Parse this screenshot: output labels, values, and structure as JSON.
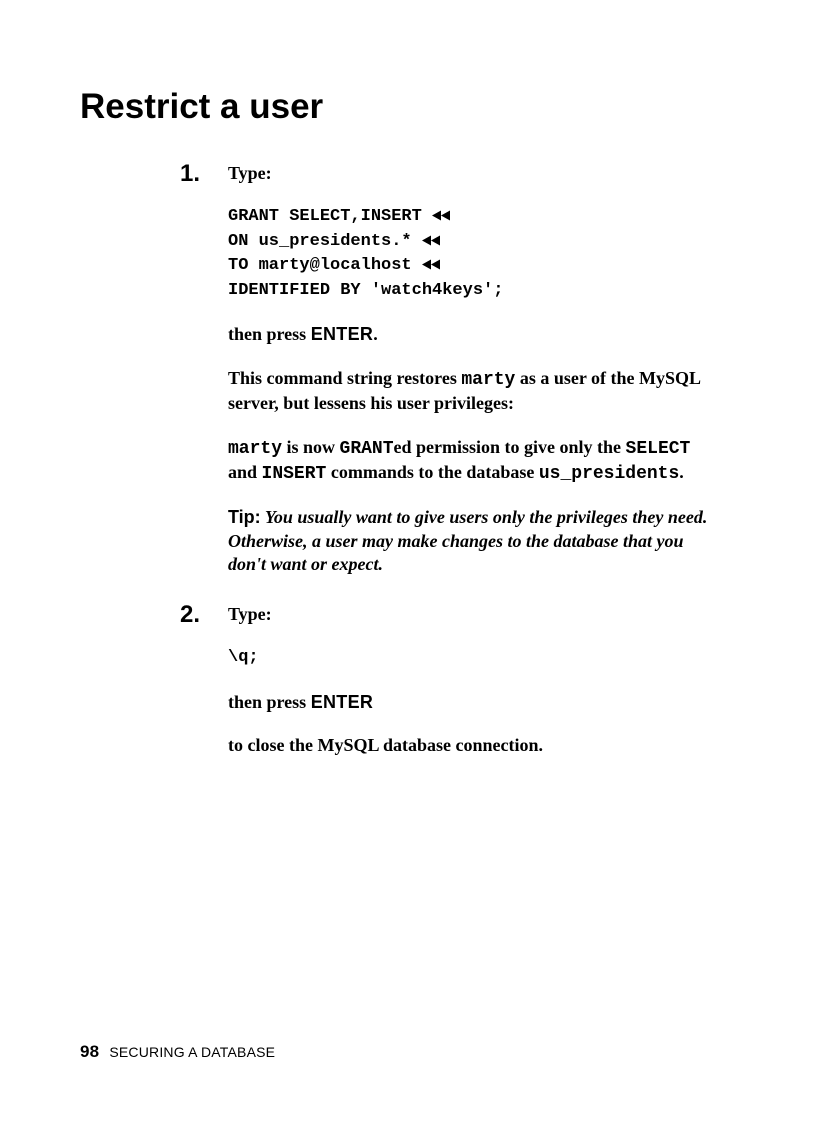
{
  "heading": "Restrict a user",
  "steps": [
    {
      "num": "1.",
      "type_label": "Type:",
      "code_lines": [
        {
          "text": "GRANT SELECT,INSERT ",
          "cont": true
        },
        {
          "text": "ON us_presidents.* ",
          "cont": true
        },
        {
          "text": "TO marty@localhost ",
          "cont": true
        },
        {
          "text": "IDENTIFIED BY 'watch4keys';",
          "cont": false
        }
      ],
      "press": {
        "pre": "then press ",
        "key": "ENTER",
        "post": "."
      },
      "para_a": {
        "pre": "This command string restores ",
        "mono1": "marty",
        "post": " as a user of the MySQL server, but lessens his user privileges:"
      },
      "para_b": {
        "mono1": "marty",
        "t1": " is now ",
        "mono2": "GRANT",
        "t2": "ed permission to give only the ",
        "mono3": "SELECT",
        "t3": " and ",
        "mono4": "INSERT",
        "t4": " commands to the database ",
        "mono5": "us_presidents",
        "t5": "."
      },
      "tip": {
        "label": "Tip:",
        "body": " You usually want to give users only the privileges they need. Otherwise, a user may make changes to the database that you don't want or expect."
      }
    },
    {
      "num": "2.",
      "type_label": "Type:",
      "code_lines": [
        {
          "text": "\\q;",
          "cont": false
        }
      ],
      "press": {
        "pre": "then press ",
        "key": "ENTER",
        "post": ""
      },
      "close_text": "to close the MySQL database connection."
    }
  ],
  "footer": {
    "page": "98",
    "title": "SECURING A DATABASE"
  }
}
